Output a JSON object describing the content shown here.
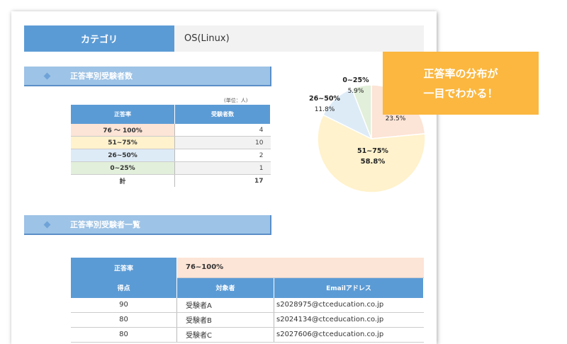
{
  "category": {
    "label": "カテゴリ",
    "value": "OS(Linux)"
  },
  "section1": {
    "title": "正答率別受験者数"
  },
  "unit_note": "(単位：人)",
  "count_table": {
    "headers": [
      "正答率",
      "受験者数"
    ],
    "rows": [
      {
        "label": "76 ～ 100%",
        "value": "4",
        "color": "#fce4d6"
      },
      {
        "label": "51~75%",
        "value": "10",
        "color": "#fff2cc"
      },
      {
        "label": "26~50%",
        "value": "2",
        "color": "#ddebf7"
      },
      {
        "label": "0~25%",
        "value": "1",
        "color": "#e2efda"
      }
    ],
    "total": {
      "label": "計",
      "value": "17"
    }
  },
  "chart_data": {
    "type": "pie",
    "slices": [
      {
        "label": "",
        "pct_label": "23.5%",
        "value": 23.5,
        "color": "#fce4d6"
      },
      {
        "label": "51~75%",
        "pct_label": "58.8%",
        "value": 58.8,
        "color": "#fff2cc"
      },
      {
        "label": "26~50%",
        "pct_label": "11.8%",
        "value": 11.8,
        "color": "#ddebf7"
      },
      {
        "label": "0~25%",
        "pct_label": "5.9%",
        "value": 5.9,
        "color": "#e2efda"
      }
    ]
  },
  "callout": {
    "line1": "正答率の分布が",
    "line2": "一目でわかる！"
  },
  "section2": {
    "title": "正答率別受験者一覧"
  },
  "list_table": {
    "band_label": "正答率",
    "band_value": "76~100%",
    "headers": [
      "得点",
      "対象者",
      "Emailアドレス"
    ],
    "rows": [
      {
        "score": "90",
        "name": "受験者A",
        "email": "s2028975@ctceducation.co.jp"
      },
      {
        "score": "80",
        "name": "受験者B",
        "email": "s2024134@ctceducation.co.jp"
      },
      {
        "score": "80",
        "name": "受験者C",
        "email": "s2027606@ctceducation.co.jp"
      }
    ]
  }
}
